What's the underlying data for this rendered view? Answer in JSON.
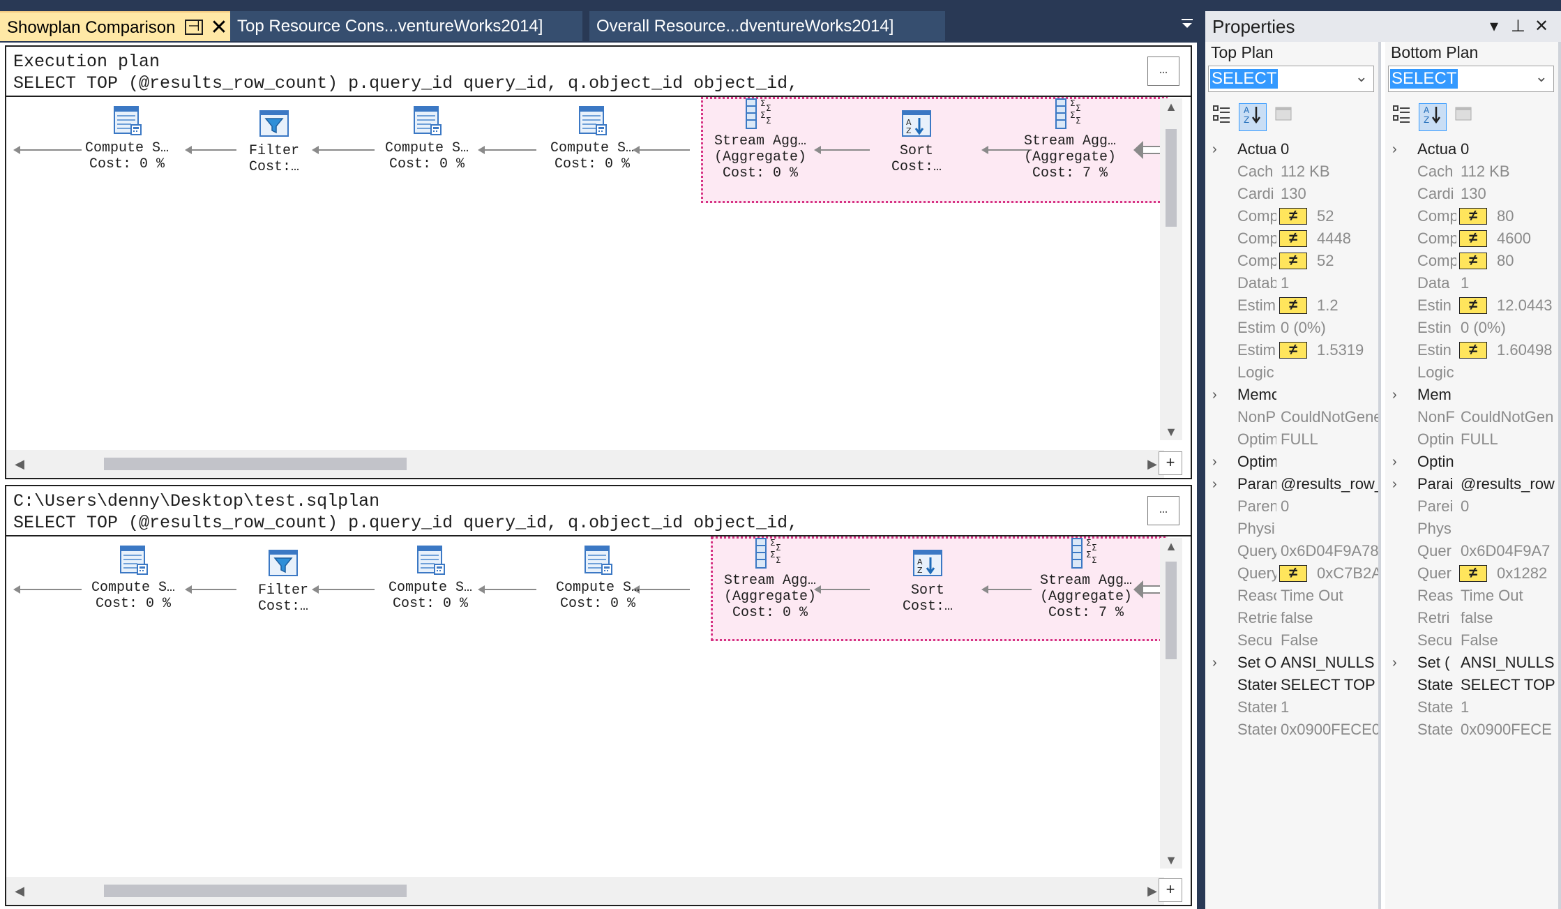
{
  "tabs": [
    {
      "label": "Showplan Comparison"
    },
    {
      "label": "Top Resource Cons...ventureWorks2014]"
    },
    {
      "label": "Overall Resource...dventureWorks2014]"
    }
  ],
  "top_plan": {
    "title": "Execution plan",
    "query": "SELECT TOP (@results_row_count) p.query_id query_id, q.object_id object_id, ISNULL(OBJECT_NAME(q.…",
    "operators": [
      {
        "name": "Compute S…",
        "line2": "",
        "cost": "Cost: 0 %"
      },
      {
        "name": "Filter",
        "line2": "",
        "cost": "Cost:…"
      },
      {
        "name": "Compute S…",
        "line2": "",
        "cost": "Cost: 0 %"
      },
      {
        "name": "Compute S…",
        "line2": "",
        "cost": "Cost: 0 %"
      },
      {
        "name": "Stream Agg…",
        "line2": "(Aggregate)",
        "cost": "Cost: 0 %"
      },
      {
        "name": "Sort",
        "line2": "",
        "cost": "Cost:…"
      },
      {
        "name": "Stream Agg…",
        "line2": "(Aggregate)",
        "cost": "Cost: 7 %"
      }
    ]
  },
  "bottom_plan": {
    "title": "C:\\Users\\denny\\Desktop\\test.sqlplan",
    "query": "SELECT TOP (@results_row_count) p.query_id query_id, q.object_id object_id, ISNULL(OBJECT_NAME(q.…",
    "operators": [
      {
        "name": "Compute S…",
        "line2": "",
        "cost": "Cost: 0 %"
      },
      {
        "name": "Filter",
        "line2": "",
        "cost": "Cost:…"
      },
      {
        "name": "Compute S…",
        "line2": "",
        "cost": "Cost: 0 %"
      },
      {
        "name": "Compute S…",
        "line2": "",
        "cost": "Cost: 0 %"
      },
      {
        "name": "Stream Agg…",
        "line2": "(Aggregate)",
        "cost": "Cost: 0 %"
      },
      {
        "name": "Sort",
        "line2": "",
        "cost": "Cost:…"
      },
      {
        "name": "Stream Agg…",
        "line2": "(Aggregate)",
        "cost": "Cost: 7 %"
      }
    ]
  },
  "properties": {
    "title": "Properties",
    "top": {
      "header": "Top Plan",
      "selected": "SELECT",
      "rows": [
        {
          "exp": true,
          "name": "Actua",
          "value": "0",
          "neq": false,
          "gray": false
        },
        {
          "exp": false,
          "name": "Cach",
          "value": "112 KB",
          "neq": false,
          "gray": true
        },
        {
          "exp": false,
          "name": "Cardi",
          "value": "130",
          "neq": false,
          "gray": true
        },
        {
          "exp": false,
          "name": "Comp",
          "value": "52",
          "neq": true,
          "gray": true
        },
        {
          "exp": false,
          "name": "Comp",
          "value": "4448",
          "neq": true,
          "gray": true
        },
        {
          "exp": false,
          "name": "Comp",
          "value": "52",
          "neq": true,
          "gray": true
        },
        {
          "exp": false,
          "name": "Datab",
          "value": "1",
          "neq": false,
          "gray": true
        },
        {
          "exp": false,
          "name": "Estim",
          "value": "1.2",
          "neq": true,
          "gray": true
        },
        {
          "exp": false,
          "name": "Estim",
          "value": "0 (0%)",
          "neq": false,
          "gray": true
        },
        {
          "exp": false,
          "name": "Estim",
          "value": "1.5319",
          "neq": true,
          "gray": true
        },
        {
          "exp": false,
          "name": "Logic",
          "value": "",
          "neq": false,
          "gray": true
        },
        {
          "exp": true,
          "name": "Memo",
          "value": "",
          "neq": false,
          "gray": false
        },
        {
          "exp": false,
          "name": "NonP",
          "value": "CouldNotGene",
          "neq": false,
          "gray": true
        },
        {
          "exp": false,
          "name": "Optim",
          "value": "FULL",
          "neq": false,
          "gray": true
        },
        {
          "exp": true,
          "name": "Optim",
          "value": "",
          "neq": false,
          "gray": false
        },
        {
          "exp": true,
          "name": "Paran",
          "value": "@results_row_",
          "neq": false,
          "gray": false
        },
        {
          "exp": false,
          "name": "Paren",
          "value": "0",
          "neq": false,
          "gray": true
        },
        {
          "exp": false,
          "name": "Physi",
          "value": "",
          "neq": false,
          "gray": true
        },
        {
          "exp": false,
          "name": "Query",
          "value": "0x6D04F9A78",
          "neq": false,
          "gray": true
        },
        {
          "exp": false,
          "name": "Query",
          "value": "0xC7B2A",
          "neq": true,
          "gray": true
        },
        {
          "exp": false,
          "name": "Reasc",
          "value": "Time Out",
          "neq": false,
          "gray": true
        },
        {
          "exp": false,
          "name": "Retrie",
          "value": "false",
          "neq": false,
          "gray": true
        },
        {
          "exp": false,
          "name": "Secu",
          "value": "False",
          "neq": false,
          "gray": true
        },
        {
          "exp": true,
          "name": "Set O",
          "value": "ANSI_NULLS",
          "neq": false,
          "gray": false
        },
        {
          "exp": false,
          "name": "Stater",
          "value": "SELECT TOP",
          "neq": false,
          "gray": false
        },
        {
          "exp": false,
          "name": "Stater",
          "value": "1",
          "neq": false,
          "gray": true
        },
        {
          "exp": false,
          "name": "Stater",
          "value": "0x0900FECE0",
          "neq": false,
          "gray": true
        }
      ]
    },
    "bottom": {
      "header": "Bottom Plan",
      "selected": "SELECT",
      "rows": [
        {
          "exp": true,
          "name": "Actua",
          "value": "0",
          "neq": false,
          "gray": false
        },
        {
          "exp": false,
          "name": "Cach",
          "value": "112 KB",
          "neq": false,
          "gray": true
        },
        {
          "exp": false,
          "name": "Cardi",
          "value": "130",
          "neq": false,
          "gray": true
        },
        {
          "exp": false,
          "name": "Comp",
          "value": "80",
          "neq": true,
          "gray": true
        },
        {
          "exp": false,
          "name": "Comp",
          "value": "4600",
          "neq": true,
          "gray": true
        },
        {
          "exp": false,
          "name": "Comp",
          "value": "80",
          "neq": true,
          "gray": true
        },
        {
          "exp": false,
          "name": "Data",
          "value": "1",
          "neq": false,
          "gray": true
        },
        {
          "exp": false,
          "name": "Estin",
          "value": "12.0443",
          "neq": true,
          "gray": true
        },
        {
          "exp": false,
          "name": "Estin",
          "value": "0 (0%)",
          "neq": false,
          "gray": true
        },
        {
          "exp": false,
          "name": "Estin",
          "value": "1.60498",
          "neq": true,
          "gray": true
        },
        {
          "exp": false,
          "name": "Logic",
          "value": "",
          "neq": false,
          "gray": true
        },
        {
          "exp": true,
          "name": "Mem",
          "value": "",
          "neq": false,
          "gray": false
        },
        {
          "exp": false,
          "name": "NonF",
          "value": "CouldNotGen",
          "neq": false,
          "gray": true
        },
        {
          "exp": false,
          "name": "Optin",
          "value": "FULL",
          "neq": false,
          "gray": true
        },
        {
          "exp": true,
          "name": "Optin",
          "value": "",
          "neq": false,
          "gray": false
        },
        {
          "exp": true,
          "name": "Parai",
          "value": "@results_row",
          "neq": false,
          "gray": false
        },
        {
          "exp": false,
          "name": "Parei",
          "value": "0",
          "neq": false,
          "gray": true
        },
        {
          "exp": false,
          "name": "Phys",
          "value": "",
          "neq": false,
          "gray": true
        },
        {
          "exp": false,
          "name": "Quer",
          "value": "0x6D04F9A7",
          "neq": false,
          "gray": true
        },
        {
          "exp": false,
          "name": "Quer",
          "value": "0x1282",
          "neq": true,
          "gray": true
        },
        {
          "exp": false,
          "name": "Reas",
          "value": "Time Out",
          "neq": false,
          "gray": true
        },
        {
          "exp": false,
          "name": "Retri",
          "value": "false",
          "neq": false,
          "gray": true
        },
        {
          "exp": false,
          "name": "Secu",
          "value": "False",
          "neq": false,
          "gray": true
        },
        {
          "exp": true,
          "name": "Set (",
          "value": "ANSI_NULLS",
          "neq": false,
          "gray": false
        },
        {
          "exp": false,
          "name": "State",
          "value": "SELECT TOP",
          "neq": false,
          "gray": false
        },
        {
          "exp": false,
          "name": "State",
          "value": "1",
          "neq": false,
          "gray": true
        },
        {
          "exp": false,
          "name": "State",
          "value": "0x0900FECE",
          "neq": false,
          "gray": true
        }
      ]
    }
  },
  "icons": {
    "compute_scalar": "compute-scalar-icon",
    "filter": "filter-icon",
    "stream_aggregate": "stream-aggregate-icon",
    "sort": "sort-icon"
  },
  "colors": {
    "accent": "#3399ff",
    "tab_active": "#ffe8a6",
    "chrome": "#293955",
    "highlight": "#fde9f3",
    "highlight_border": "#d63384",
    "neq": "#ffe55c"
  }
}
